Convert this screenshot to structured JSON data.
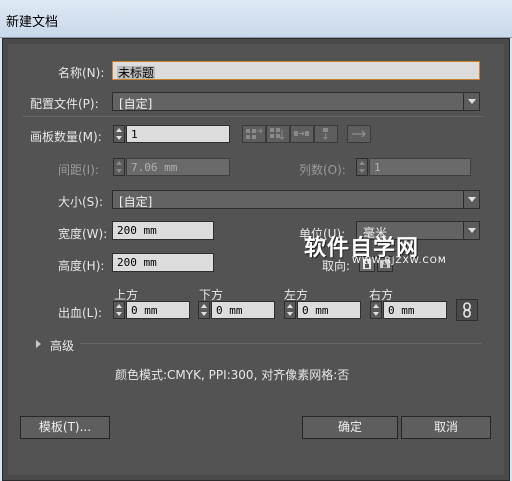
{
  "window": {
    "title": "新建文档"
  },
  "name": {
    "label": "名称(N):",
    "value": "未标题"
  },
  "profile": {
    "label": "配置文件(P):",
    "value": "[自定]"
  },
  "artboards": {
    "label": "画板数量(M):",
    "value": "1"
  },
  "spacing": {
    "label": "间距(I):",
    "value": "7.06 mm"
  },
  "columns": {
    "label": "列数(O):",
    "value": "1"
  },
  "size": {
    "label": "大小(S):",
    "value": "[自定]"
  },
  "width": {
    "label": "宽度(W):",
    "value": "200 mm"
  },
  "height": {
    "label": "高度(H):",
    "value": "200 mm"
  },
  "units": {
    "label": "单位(U):",
    "value": "毫米"
  },
  "orientation": {
    "label": "取向:"
  },
  "bleed": {
    "label": "出血(L):",
    "top": {
      "label": "上方",
      "value": "0 mm"
    },
    "bottom": {
      "label": "下方",
      "value": "0 mm"
    },
    "left": {
      "label": "左方",
      "value": "0 mm"
    },
    "right": {
      "label": "右方",
      "value": "0 mm"
    }
  },
  "advanced": {
    "label": "高级"
  },
  "info": {
    "text": "颜色模式:CMYK, PPI:300, 对齐像素网格:否"
  },
  "buttons": {
    "templates": "模板(T)...",
    "ok": "确定",
    "cancel": "取消"
  },
  "watermark": {
    "text": "软件自学网",
    "sub": "WWW.RJZXW.COM"
  },
  "icons": [
    "spinner-icon",
    "grid-by-row-icon",
    "grid-by-column-icon",
    "arrange-by-row-icon",
    "arrange-by-column-icon",
    "direction-arrow-icon",
    "link-icon",
    "portrait-icon",
    "landscape-icon",
    "disclosure-triangle-icon"
  ]
}
